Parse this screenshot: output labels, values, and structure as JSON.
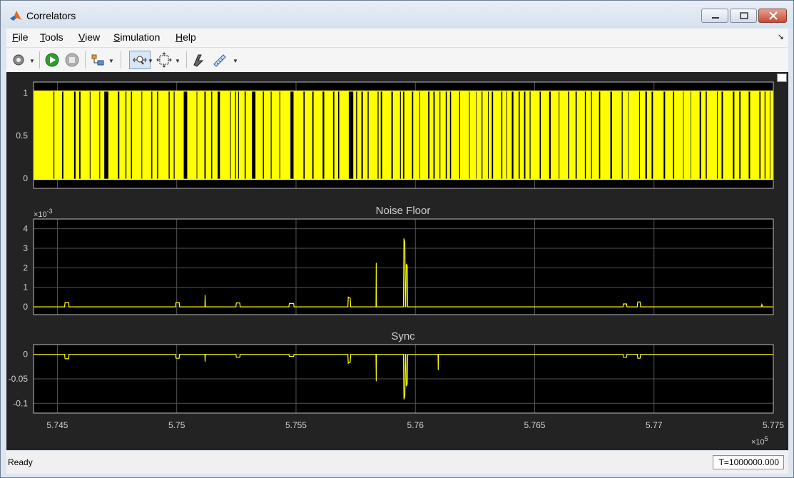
{
  "window": {
    "title": "Correlators",
    "title_icon": "matlab-logo-icon",
    "controls": {
      "minimize": "minimize-icon",
      "maximize": "maximize-icon",
      "close": "close-icon"
    }
  },
  "menu": {
    "items": [
      "File",
      "Tools",
      "View",
      "Simulation",
      "Help"
    ]
  },
  "toolbar": {
    "icons": [
      "settings-gear-icon",
      "run-icon",
      "stop-icon",
      "signal-selector-icon",
      "zoom-icon",
      "autoscale-icon",
      "highlight-icon",
      "measurements-icon"
    ]
  },
  "colors": {
    "plot_background": "#000000",
    "figure_background": "#232323",
    "trace": "#ffff00",
    "grid": "#555555",
    "axis_text": "#d0d0d0"
  },
  "chart_data": [
    {
      "type": "line",
      "title": "",
      "x_axis_shared": true,
      "xlim": [
        574400,
        577500
      ],
      "ylim": [
        -0.1,
        1.1
      ],
      "y_ticks": [
        "1",
        "0.5",
        "0"
      ],
      "series": [
        {
          "values_description_levels": [
            0,
            1
          ],
          "pattern": "binary square wave toggling rapidly between 0 and 1"
        }
      ],
      "grid": true
    },
    {
      "type": "line",
      "title": "Noise Floor",
      "y_exponent": "×10",
      "y_exponent_power": "-3",
      "ylim": [
        -0.4,
        4.5
      ],
      "y_ticks": [
        "4",
        "3",
        "2",
        "1",
        "0"
      ],
      "series": [
        {
          "points": [
            [
              574400,
              0
            ],
            [
              574530,
              0
            ],
            [
              574532,
              0.22
            ],
            [
              574547,
              0.22
            ],
            [
              574549,
              0
            ],
            [
              574995,
              0
            ],
            [
              574997,
              0.23
            ],
            [
              575010,
              0.23
            ],
            [
              575012,
              0
            ],
            [
              575118,
              0
            ],
            [
              575119,
              0.6
            ],
            [
              575120,
              0
            ],
            [
              575248,
              0
            ],
            [
              575250,
              0.2
            ],
            [
              575264,
              0.2
            ],
            [
              575266,
              0
            ],
            [
              575470,
              0
            ],
            [
              575472,
              0.17
            ],
            [
              575490,
              0.17
            ],
            [
              575492,
              0
            ],
            [
              575717,
              0
            ],
            [
              575719,
              0.5
            ],
            [
              575727,
              0.45
            ],
            [
              575729,
              0
            ],
            [
              575835,
              0
            ],
            [
              575836,
              2.25
            ],
            [
              575837,
              0
            ],
            [
              575950,
              0
            ],
            [
              575952,
              3.5
            ],
            [
              575956,
              3.3
            ],
            [
              575958,
              0
            ],
            [
              575960,
              0
            ],
            [
              575962,
              2.2
            ],
            [
              575966,
              2.1
            ],
            [
              575968,
              0
            ],
            [
              576870,
              0
            ],
            [
              576872,
              0.15
            ],
            [
              576885,
              0.15
            ],
            [
              576887,
              0
            ],
            [
              576930,
              0
            ],
            [
              576932,
              0.25
            ],
            [
              576942,
              0.25
            ],
            [
              576944,
              0
            ],
            [
              577450,
              0
            ],
            [
              577452,
              0.12
            ],
            [
              577456,
              0
            ],
            [
              577500,
              0
            ]
          ]
        }
      ],
      "grid": true
    },
    {
      "type": "line",
      "title": "Sync",
      "ylim": [
        -0.12,
        0.02
      ],
      "y_ticks": [
        "0",
        "-0.05",
        "-0.1"
      ],
      "x_ticks": [
        "5.745",
        "5.75",
        "5.755",
        "5.76",
        "5.765",
        "5.77",
        "5.775"
      ],
      "x_exponent": "×10",
      "x_exponent_power": "5",
      "series": [
        {
          "points": [
            [
              574400,
              0
            ],
            [
              574530,
              0
            ],
            [
              574532,
              -0.009
            ],
            [
              574547,
              -0.009
            ],
            [
              574549,
              0
            ],
            [
              574995,
              0
            ],
            [
              574997,
              -0.008
            ],
            [
              575010,
              -0.008
            ],
            [
              575012,
              0
            ],
            [
              575118,
              0
            ],
            [
              575119,
              -0.015
            ],
            [
              575120,
              0
            ],
            [
              575248,
              0
            ],
            [
              575250,
              -0.006
            ],
            [
              575264,
              -0.006
            ],
            [
              575266,
              0
            ],
            [
              575470,
              0
            ],
            [
              575472,
              -0.004
            ],
            [
              575490,
              -0.004
            ],
            [
              575492,
              0
            ],
            [
              575717,
              0
            ],
            [
              575719,
              -0.018
            ],
            [
              575727,
              -0.016
            ],
            [
              575729,
              0
            ],
            [
              575835,
              0
            ],
            [
              575836,
              -0.055
            ],
            [
              575837,
              0
            ],
            [
              575950,
              0
            ],
            [
              575952,
              -0.092
            ],
            [
              575956,
              -0.085
            ],
            [
              575958,
              0
            ],
            [
              575960,
              0
            ],
            [
              575962,
              -0.065
            ],
            [
              575966,
              -0.06
            ],
            [
              575968,
              0
            ],
            [
              576095,
              0
            ],
            [
              576096,
              -0.032
            ],
            [
              576097,
              0
            ],
            [
              576870,
              0
            ],
            [
              576872,
              -0.006
            ],
            [
              576885,
              -0.006
            ],
            [
              576887,
              0
            ],
            [
              576930,
              0
            ],
            [
              576932,
              -0.008
            ],
            [
              576942,
              -0.008
            ],
            [
              576944,
              0
            ],
            [
              577500,
              0
            ]
          ]
        }
      ],
      "grid": true
    }
  ],
  "status": {
    "text": "Ready",
    "time": "T=1000000.000"
  }
}
